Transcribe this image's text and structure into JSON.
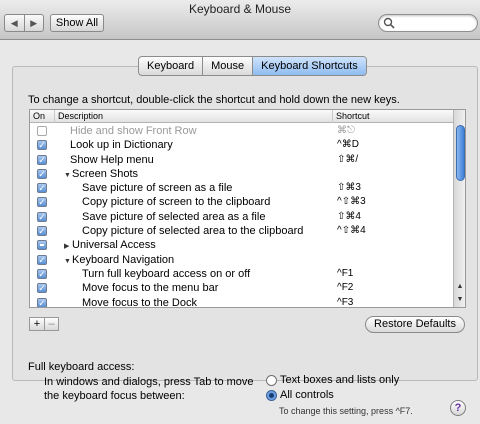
{
  "window": {
    "title": "Keyboard & Mouse"
  },
  "toolbar": {
    "back_icon": "back-arrow-icon",
    "forward_icon": "forward-arrow-icon",
    "show_all_label": "Show All",
    "search_placeholder": ""
  },
  "tabs": [
    {
      "label": "Keyboard",
      "selected": false
    },
    {
      "label": "Mouse",
      "selected": false
    },
    {
      "label": "Keyboard Shortcuts",
      "selected": true
    }
  ],
  "instructions": "To change a shortcut, double-click the shortcut and hold down the new keys.",
  "table": {
    "columns": [
      "On",
      "Description",
      "Shortcut"
    ],
    "rows": [
      {
        "state": "off",
        "type": "item",
        "description": "Hide and show Front Row",
        "shortcut": "⌘⎋",
        "disabled": true
      },
      {
        "state": "on",
        "type": "item",
        "description": "Look up in Dictionary",
        "shortcut": "^⌘D"
      },
      {
        "state": "on",
        "type": "item",
        "description": "Show Help menu",
        "shortcut": "⇧⌘/"
      },
      {
        "state": "on",
        "type": "group-open",
        "description": "Screen Shots",
        "shortcut": ""
      },
      {
        "state": "on",
        "type": "child",
        "description": "Save picture of screen as a file",
        "shortcut": "⇧⌘3"
      },
      {
        "state": "on",
        "type": "child",
        "description": "Copy picture of screen to the clipboard",
        "shortcut": "^⇧⌘3"
      },
      {
        "state": "on",
        "type": "child",
        "description": "Save picture of selected area as a file",
        "shortcut": "⇧⌘4"
      },
      {
        "state": "on",
        "type": "child",
        "description": "Copy picture of selected area to the clipboard",
        "shortcut": "^⇧⌘4"
      },
      {
        "state": "mixed",
        "type": "group-closed",
        "description": "Universal Access",
        "shortcut": ""
      },
      {
        "state": "on",
        "type": "group-open",
        "description": "Keyboard Navigation",
        "shortcut": ""
      },
      {
        "state": "on",
        "type": "child",
        "description": "Turn full keyboard access on or off",
        "shortcut": "^F1"
      },
      {
        "state": "on",
        "type": "child",
        "description": "Move focus to the menu bar",
        "shortcut": "^F2"
      },
      {
        "state": "on",
        "type": "child",
        "description": "Move focus to the Dock",
        "shortcut": "^F3"
      }
    ]
  },
  "buttons": {
    "add": "+",
    "remove": "–",
    "restore_defaults": "Restore Defaults"
  },
  "full_keyboard_access": {
    "title": "Full keyboard access:",
    "prompt": "In windows and dialogs, press Tab to move the keyboard focus between:",
    "options": [
      {
        "label": "Text boxes and lists only",
        "selected": false
      },
      {
        "label": "All controls",
        "selected": true
      }
    ],
    "note": "To change this setting, press ^F7."
  },
  "help_label": "?"
}
